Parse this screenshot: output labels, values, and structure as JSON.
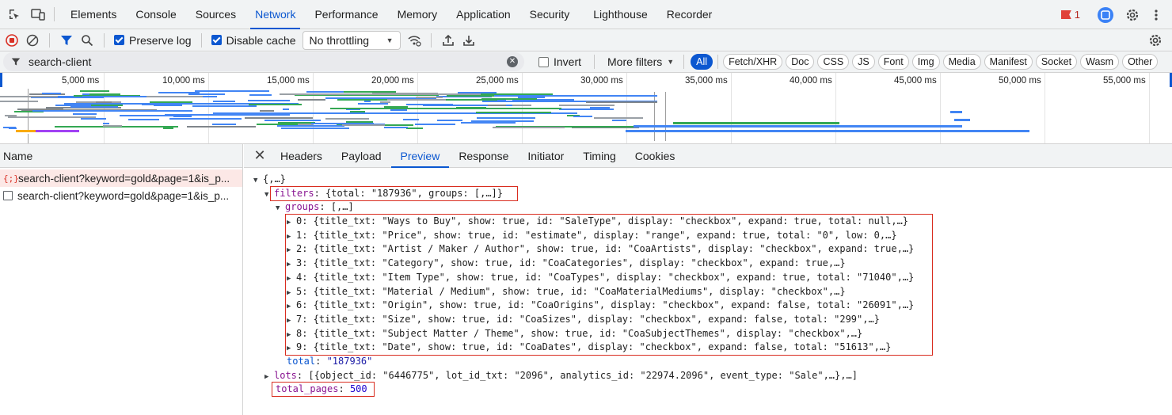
{
  "tabs": [
    {
      "label": "Elements"
    },
    {
      "label": "Console"
    },
    {
      "label": "Sources"
    },
    {
      "label": "Network",
      "active": true
    },
    {
      "label": "Performance"
    },
    {
      "label": "Memory"
    },
    {
      "label": "Application"
    },
    {
      "label": "Security"
    },
    {
      "label": "Lighthouse"
    },
    {
      "label": "Recorder"
    }
  ],
  "issues_count": "1",
  "toolbar": {
    "preserve_log": "Preserve log",
    "disable_cache": "Disable cache",
    "throttling": "No throttling"
  },
  "filter": {
    "value": "search-client",
    "invert": "Invert",
    "more_filters": "More filters",
    "types": [
      "All",
      "Fetch/XHR",
      "Doc",
      "CSS",
      "JS",
      "Font",
      "Img",
      "Media",
      "Manifest",
      "Socket",
      "Wasm",
      "Other"
    ]
  },
  "timeline_ticks": [
    "5,000 ms",
    "10,000 ms",
    "15,000 ms",
    "20,000 ms",
    "25,000 ms",
    "30,000 ms",
    "35,000 ms",
    "40,000 ms",
    "45,000 ms",
    "50,000 ms",
    "55,000 ms"
  ],
  "requests": {
    "header": "Name",
    "rows": [
      {
        "name": "search-client?keyword=gold&page=1&is_p...",
        "icon": "{;}",
        "selected": true
      },
      {
        "name": "search-client?keyword=gold&page=1&is_p...",
        "icon": "",
        "selected": false
      }
    ]
  },
  "detail_tabs": [
    "Headers",
    "Payload",
    "Preview",
    "Response",
    "Initiator",
    "Timing",
    "Cookies"
  ],
  "colors": {
    "accent": "#0b57d0",
    "highlight": "#d92d20",
    "json_key": "#881391",
    "json_string": "#1a1aa6"
  },
  "preview": {
    "root": "{,…}",
    "filters_key": "filters",
    "filters_val": "{total: \"187936\", groups: [,…]}",
    "groups_key": "groups",
    "groups_val": "[,…]",
    "groups": [
      "0: {title_txt: \"Ways to Buy\", show: true, id: \"SaleType\", display: \"checkbox\", expand: true, total: null,…}",
      "1: {title_txt: \"Price\", show: true, id: \"estimate\", display: \"range\", expand: true, total: \"0\", low: 0,…}",
      "2: {title_txt: \"Artist / Maker / Author\", show: true, id: \"CoaArtists\", display: \"checkbox\", expand: true,…}",
      "3: {title_txt: \"Category\", show: true, id: \"CoaCategories\", display: \"checkbox\", expand: true,…}",
      "4: {title_txt: \"Item Type\", show: true, id: \"CoaTypes\", display: \"checkbox\", expand: true, total: \"71040\",…}",
      "5: {title_txt: \"Material / Medium\", show: true, id: \"CoaMaterialMediums\", display: \"checkbox\",…}",
      "6: {title_txt: \"Origin\", show: true, id: \"CoaOrigins\", display: \"checkbox\", expand: false, total: \"26091\",…}",
      "7: {title_txt: \"Size\", show: true, id: \"CoaSizes\", display: \"checkbox\", expand: false, total: \"299\",…}",
      "8: {title_txt: \"Subject Matter / Theme\", show: true, id: \"CoaSubjectThemes\", display: \"checkbox\",…}",
      "9: {title_txt: \"Date\", show: true, id: \"CoaDates\", display: \"checkbox\", expand: false, total: \"51613\",…}"
    ],
    "total_key": "total",
    "total_val": "\"187936\"",
    "lots_key": "lots",
    "lots_val": "[{object_id: \"6446775\", lot_id_txt: \"2096\", analytics_id: \"22974.2096\", event_type: \"Sale\",…},…]",
    "total_pages_key": "total_pages",
    "total_pages_val": "500"
  }
}
